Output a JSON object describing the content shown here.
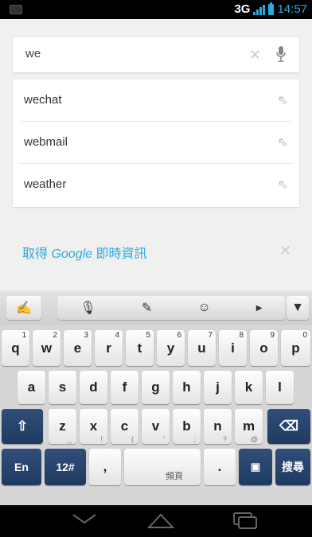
{
  "status": {
    "network": "3G",
    "time": "14:57"
  },
  "search": {
    "value": "we"
  },
  "suggestions": [
    {
      "label": "wechat"
    },
    {
      "label": "webmail"
    },
    {
      "label": "weather"
    }
  ],
  "google_now": {
    "prefix": "取得 ",
    "brand": "Google",
    "suffix": " 即時資訊"
  },
  "keyboard": {
    "row1": [
      {
        "label": "q",
        "sub": "1"
      },
      {
        "label": "w",
        "sub": "2"
      },
      {
        "label": "e",
        "sub": "3"
      },
      {
        "label": "r",
        "sub": "4"
      },
      {
        "label": "t",
        "sub": "5"
      },
      {
        "label": "y",
        "sub": "6"
      },
      {
        "label": "u",
        "sub": "7"
      },
      {
        "label": "i",
        "sub": "8"
      },
      {
        "label": "o",
        "sub": "9"
      },
      {
        "label": "p",
        "sub": "0"
      }
    ],
    "row2": [
      "a",
      "s",
      "d",
      "f",
      "g",
      "h",
      "j",
      "k",
      "l"
    ],
    "row3": [
      {
        "label": "z",
        "hint": "_"
      },
      {
        "label": "x",
        "hint": "!"
      },
      {
        "label": "c",
        "hint": "("
      },
      {
        "label": "v",
        "hint": "'"
      },
      {
        "label": "b",
        "hint": ";"
      },
      {
        "label": "n",
        "hint": "?"
      },
      {
        "label": "m",
        "hint": "@"
      }
    ],
    "lang_key": "En",
    "symbol_key": "12#",
    "comma_key": ",",
    "space_label": "頻頁",
    "period_key": ".",
    "search_key": "搜尋"
  },
  "colors": {
    "accent": "#2aa9e0",
    "keyboard_dark": "#1f3a5f"
  }
}
